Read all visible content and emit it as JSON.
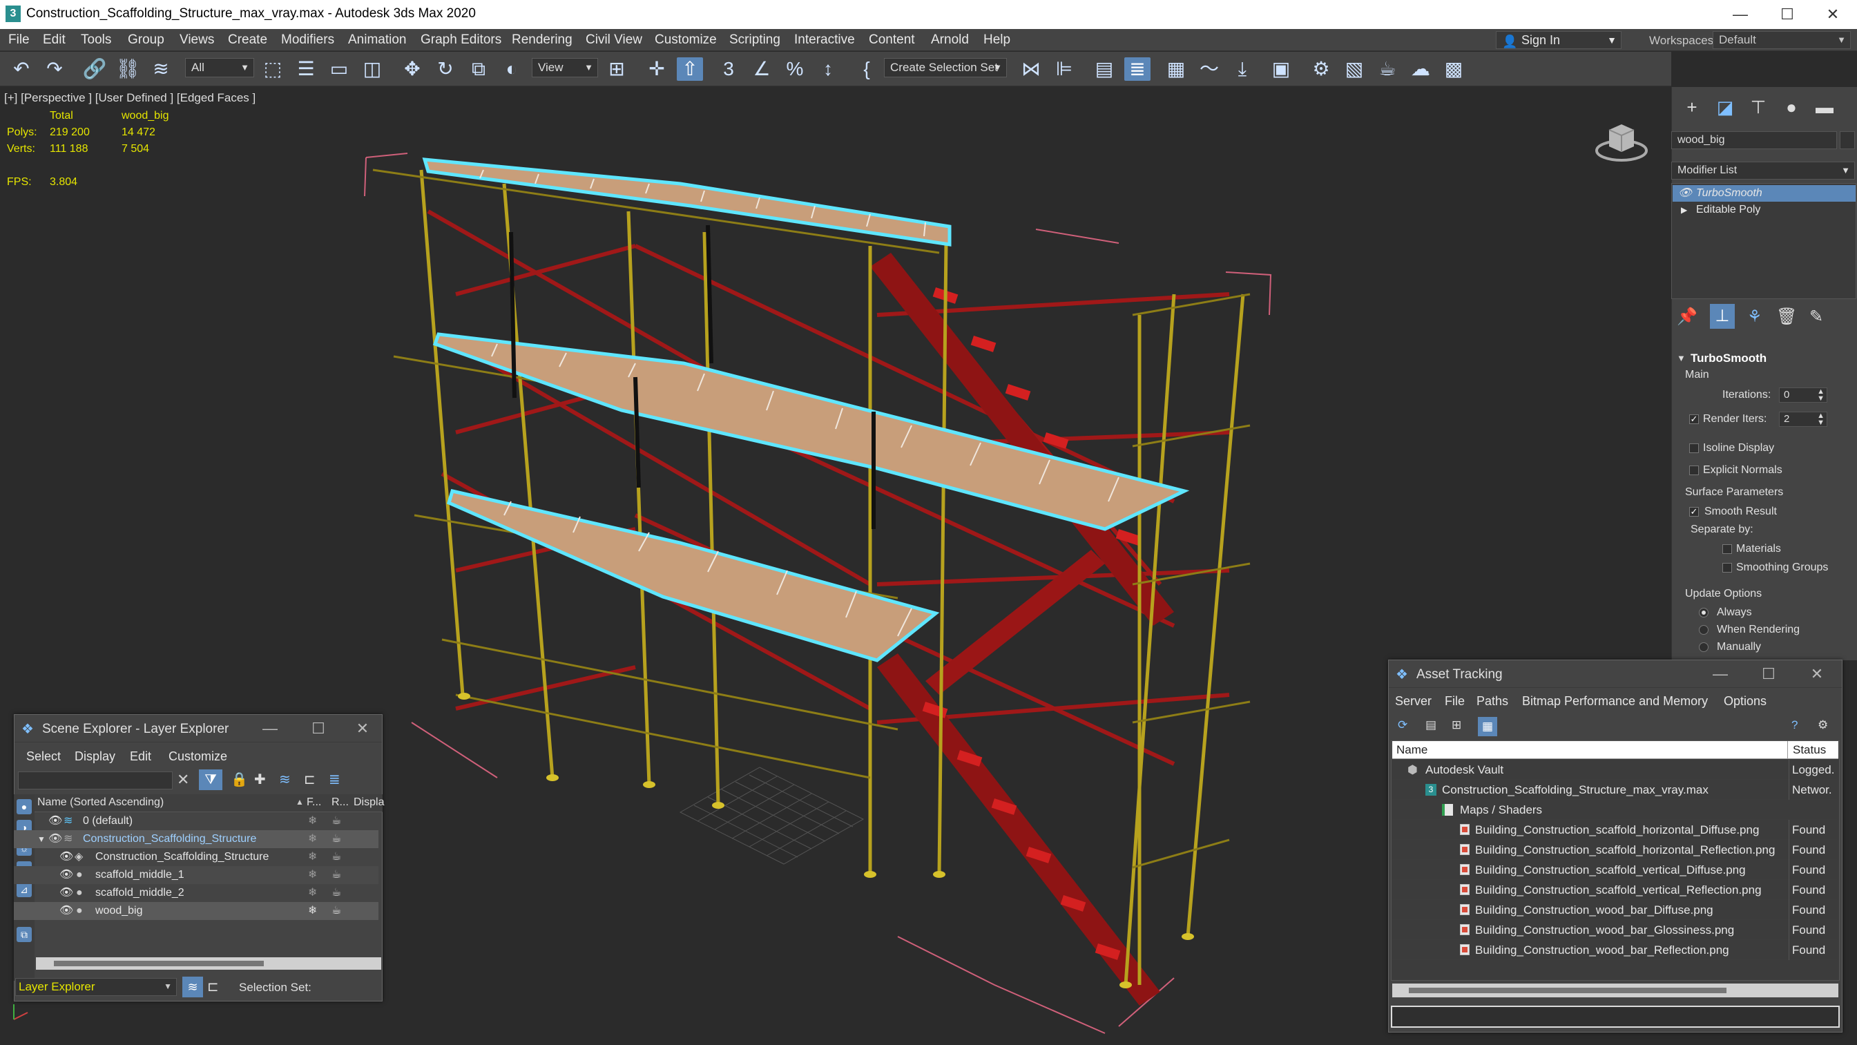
{
  "window": {
    "title": "Construction_Scaffolding_Structure_max_vray.max - Autodesk 3ds Max 2020",
    "controls": {
      "minimize": "—",
      "maximize": "☐",
      "close": "✕"
    }
  },
  "menu": {
    "items": [
      "File",
      "Edit",
      "Tools",
      "Group",
      "Views",
      "Create",
      "Modifiers",
      "Animation",
      "Graph Editors",
      "Rendering",
      "Civil View",
      "Customize",
      "Scripting",
      "Interactive",
      "Content",
      "Arnold",
      "Help"
    ],
    "sign_in": "Sign In",
    "workspaces_label": "Workspaces:",
    "workspace_value": "Default"
  },
  "toolbar": {
    "filter_value": "All",
    "refcoord_value": "View",
    "selection_set_placeholder": "Create Selection Set"
  },
  "viewport": {
    "label": "[+] [Perspective ] [User Defined ] [Edged Faces ]",
    "stats": {
      "col_total": "Total",
      "col_object": "wood_big",
      "polys_label": "Polys:",
      "polys_total": "219 200",
      "polys_object": "14 472",
      "verts_label": "Verts:",
      "verts_total": "111 188",
      "verts_object": "7 504",
      "fps_label": "FPS:",
      "fps_value": "3.804"
    }
  },
  "command_panel": {
    "object_name": "wood_big",
    "modifier_list_label": "Modifier List",
    "stack": [
      "TurboSmooth",
      "Editable Poly"
    ],
    "rollout_title": "TurboSmooth",
    "main_label": "Main",
    "iterations_label": "Iterations:",
    "iterations_value": "0",
    "render_iters_label": "Render Iters:",
    "render_iters_value": "2",
    "isoline_display": "Isoline Display",
    "explicit_normals": "Explicit Normals",
    "surface_parameters": "Surface Parameters",
    "smooth_result": "Smooth Result",
    "separate_by": "Separate by:",
    "materials": "Materials",
    "smoothing_groups": "Smoothing Groups",
    "update_options": "Update Options",
    "always": "Always",
    "when_rendering": "When Rendering",
    "manually": "Manually"
  },
  "scene_explorer": {
    "title": "Scene Explorer - Layer Explorer",
    "menu": [
      "Select",
      "Display",
      "Edit",
      "Customize"
    ],
    "columns": {
      "name": "Name (Sorted Ascending)",
      "f": "F...",
      "r": "R...",
      "display": "Displa"
    },
    "rows": [
      {
        "name": "0 (default)"
      },
      {
        "name": "Construction_Scaffolding_Structure"
      },
      {
        "name": "Construction_Scaffolding_Structure"
      },
      {
        "name": "scaffold_middle_1"
      },
      {
        "name": "scaffold_middle_2"
      },
      {
        "name": "wood_big"
      }
    ],
    "footer_explorer": "Layer Explorer",
    "footer_selection_set": "Selection Set:"
  },
  "asset_tracking": {
    "title": "Asset Tracking",
    "menu": [
      "Server",
      "File",
      "Paths",
      "Bitmap Performance and Memory",
      "Options"
    ],
    "columns": {
      "name": "Name",
      "status": "Status"
    },
    "rows": [
      {
        "name": "Autodesk Vault",
        "status": "Logged."
      },
      {
        "name": "Construction_Scaffolding_Structure_max_vray.max",
        "status": "Networ."
      },
      {
        "name": "Maps / Shaders",
        "status": ""
      },
      {
        "name": "Building_Construction_scaffold_horizontal_Diffuse.png",
        "status": "Found"
      },
      {
        "name": "Building_Construction_scaffold_horizontal_Reflection.png",
        "status": "Found"
      },
      {
        "name": "Building_Construction_scaffold_vertical_Diffuse.png",
        "status": "Found"
      },
      {
        "name": "Building_Construction_scaffold_vertical_Reflection.png",
        "status": "Found"
      },
      {
        "name": "Building_Construction_wood_bar_Diffuse.png",
        "status": "Found"
      },
      {
        "name": "Building_Construction_wood_bar_Glossiness.png",
        "status": "Found"
      },
      {
        "name": "Building_Construction_wood_bar_Reflection.png",
        "status": "Found"
      }
    ]
  },
  "colors": {
    "accent_blue": "#5b87b8",
    "selection_cyan": "#5fe6ff",
    "scaffold_yellow": "#b7a21e",
    "brace_red": "#a01818",
    "bounding_pink": "#d0607a"
  }
}
